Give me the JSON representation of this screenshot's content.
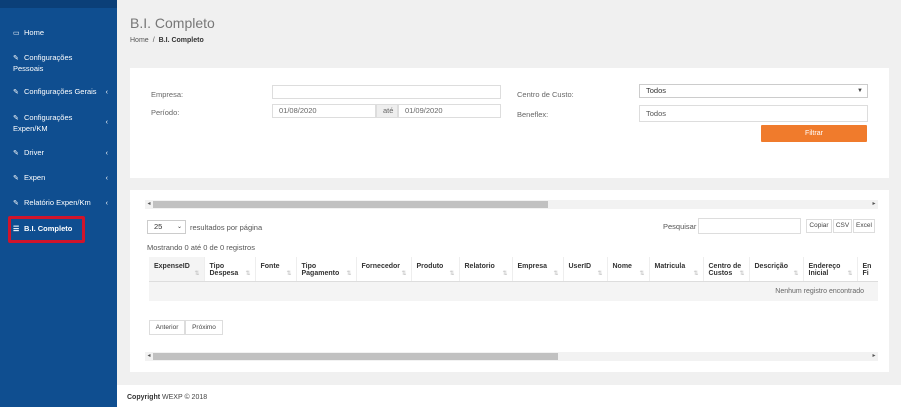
{
  "sidebar": {
    "items": [
      {
        "icon": "monitor-icon",
        "glyph": "▭",
        "label": "Home"
      },
      {
        "icon": "edit-icon",
        "glyph": "✎",
        "label": "Configurações Pessoais"
      },
      {
        "icon": "edit-icon",
        "glyph": "✎",
        "label": "Configurações Gerais"
      },
      {
        "icon": "edit-icon",
        "glyph": "✎",
        "label": "Configurações Expen/KM"
      },
      {
        "icon": "edit-icon",
        "glyph": "✎",
        "label": "Driver"
      },
      {
        "icon": "edit-icon",
        "glyph": "✎",
        "label": "Expen"
      },
      {
        "icon": "edit-icon",
        "glyph": "✎",
        "label": "Relatório Expen/Km"
      },
      {
        "icon": "list-icon",
        "glyph": "☰",
        "label": "B.I. Completo"
      }
    ],
    "chevron": "‹"
  },
  "header": {
    "title": "B.I. Completo",
    "breadcrumb": {
      "home": "Home",
      "sep": "/",
      "current": "B.I. Completo"
    }
  },
  "filters": {
    "empresa_label": "Empresa:",
    "periodo_label": "Período:",
    "start_date": "01/08/2020",
    "ate_label": "até",
    "end_date": "01/09/2020",
    "centro_label": "Centro de Custo:",
    "centro_value": "Todos",
    "beneflex_label": "Beneflex:",
    "beneflex_value": "Todos",
    "filter_button": "Filtrar"
  },
  "table_controls": {
    "page_size": "25",
    "page_size_label": "resultados por página",
    "search_label": "Pesquisar",
    "copy_button": "Copiar",
    "csv_button": "CSV",
    "excel_button": "Excel",
    "info": "Mostrando 0 até 0 de 0 registros"
  },
  "table": {
    "columns": [
      "ExpenseID",
      "Tipo Despesa",
      "Fonte",
      "Tipo Pagamento",
      "Fornecedor",
      "Produto",
      "Relatorio",
      "Empresa",
      "UserID",
      "Nome",
      "Matricula",
      "Centro de Custos",
      "Descrição",
      "Endereço Inicial",
      "En Fi"
    ],
    "empty_message": "Nenhum registro encontrado"
  },
  "pagination": {
    "prev": "Anterior",
    "next": "Próximo"
  },
  "footer": {
    "copyright": "Copyright",
    "brand": "WEXP © 2018"
  }
}
